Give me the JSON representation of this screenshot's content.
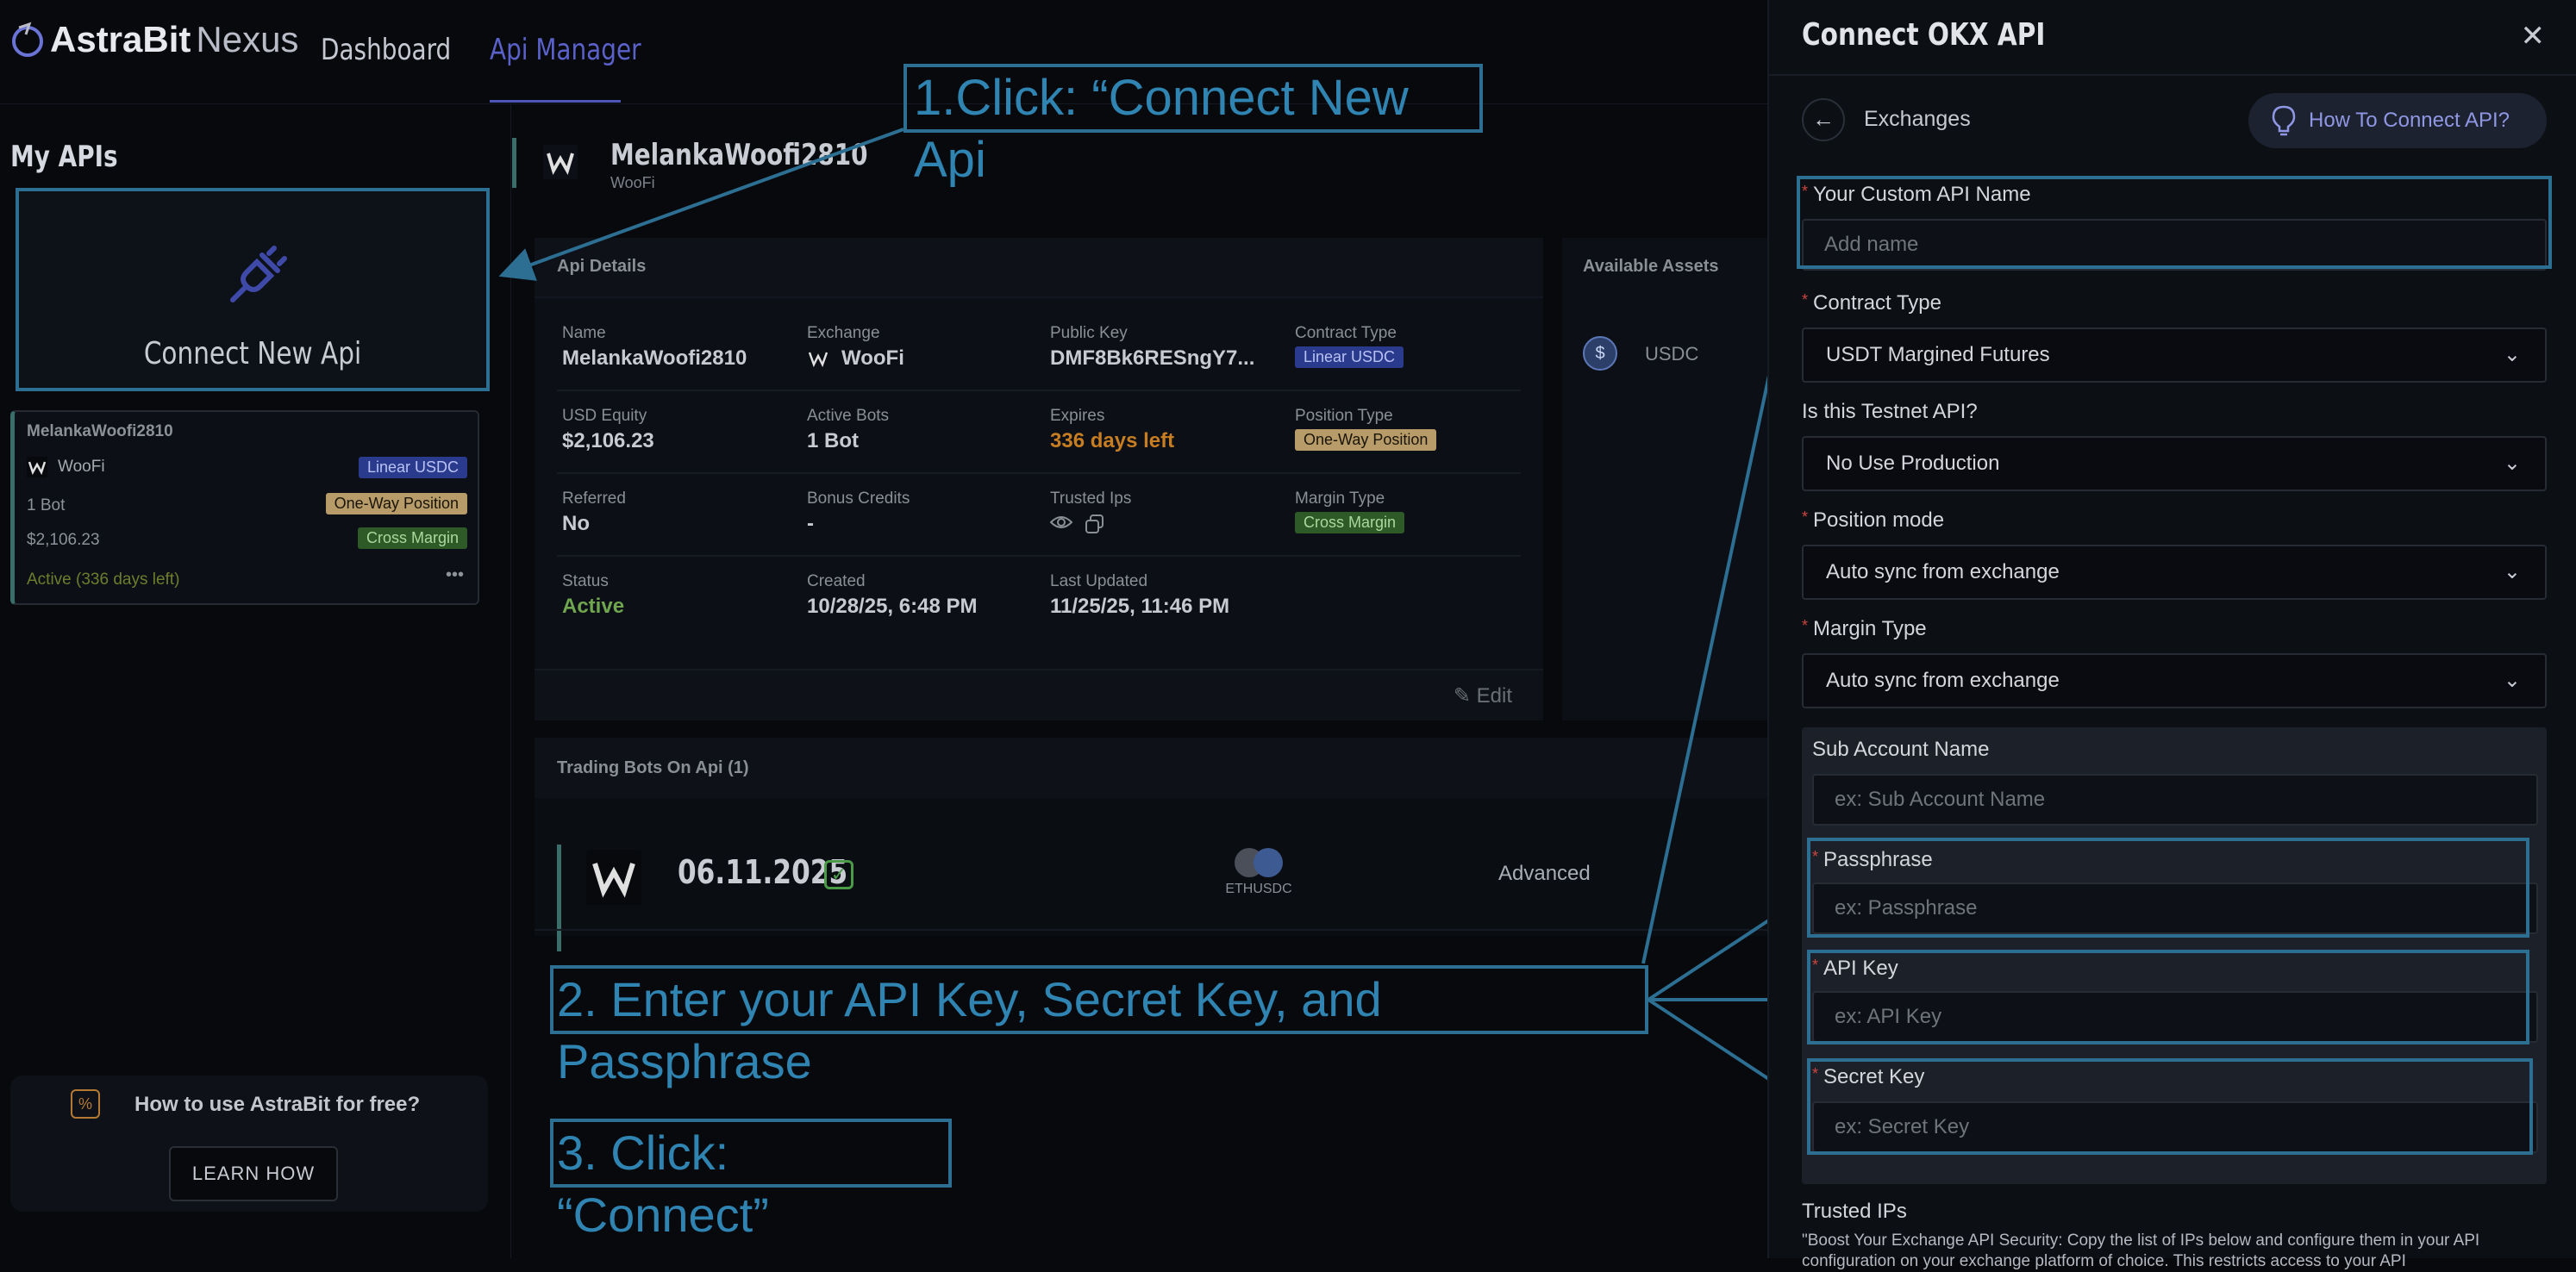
{
  "brand": {
    "name_bold": "AstraBit",
    "name_thin": "Nexus"
  },
  "nav": {
    "dashboard": "Dashboard",
    "api_manager": "Api Manager"
  },
  "left": {
    "my_apis": "My APIs",
    "connect_new": "Connect New Api",
    "card": {
      "name": "MelankaWoofi2810",
      "exchange": "WooFi",
      "tag_contract": "Linear USDC",
      "bots": "1 Bot",
      "tag_position": "One-Way Position",
      "equity": "$2,106.23",
      "tag_margin": "Cross Margin",
      "status": "Active (336 days left)",
      "more": "•••"
    },
    "free": {
      "question": "How to use AstraBit for free?",
      "button": "LEARN HOW"
    }
  },
  "main": {
    "api_name": "MelankaWoofi2810",
    "api_exchange": "WooFi",
    "details": {
      "title": "Api Details",
      "name_label": "Name",
      "name_value": "MelankaWoofi2810",
      "exchange_label": "Exchange",
      "exchange_value": "WooFi",
      "pubkey_label": "Public Key",
      "pubkey_value": "DMF8Bk6RESngY7...",
      "contract_label": "Contract Type",
      "contract_value": "Linear USDC",
      "equity_label": "USD Equity",
      "equity_value": "$2,106.23",
      "activebots_label": "Active Bots",
      "activebots_value": "1 Bot",
      "expires_label": "Expires",
      "expires_value": "336 days left",
      "position_label": "Position Type",
      "position_value": "One-Way Position",
      "referred_label": "Referred",
      "referred_value": "No",
      "bonus_label": "Bonus Credits",
      "bonus_value": "-",
      "trusted_label": "Trusted Ips",
      "margin_label": "Margin Type",
      "margin_value": "Cross Margin",
      "status_label": "Status",
      "status_value": "Active",
      "created_label": "Created",
      "created_value": "10/28/25, 6:48 PM",
      "updated_label": "Last Updated",
      "updated_value": "11/25/25, 11:46 PM",
      "edit": "Edit"
    },
    "assets": {
      "title": "Available Assets",
      "coin": "USDC"
    },
    "bots": {
      "title": "Trading Bots On Api (1)",
      "date": "06.11.2025",
      "pair": "ETHUSDC",
      "type": "Advanced"
    }
  },
  "annotations": {
    "step1": "1.Click: “Connect New Api",
    "step2": "2. Enter your API Key, Secret Key, and Passphrase",
    "step3": "3. Click: “Connect”"
  },
  "panel": {
    "title": "Connect OKX API",
    "close": "✕",
    "back_label": "Exchanges",
    "howto": "How To Connect API?",
    "custom_name_label": "Your Custom API Name",
    "custom_name_placeholder": "Add name",
    "contract_label": "Contract Type",
    "contract_value": "USDT Margined Futures",
    "testnet_label": "Is this Testnet API?",
    "testnet_value": "No Use Production",
    "position_label": "Position mode",
    "position_value": "Auto sync from exchange",
    "margin_label": "Margin Type",
    "margin_value": "Auto sync from exchange",
    "sub_label": "Sub Account Name",
    "sub_placeholder": "ex: Sub Account Name",
    "pass_label": "Passphrase",
    "pass_placeholder": "ex: Passphrase",
    "apikey_label": "API Key",
    "apikey_placeholder": "ex: API Key",
    "secret_label": "Secret Key",
    "secret_placeholder": "ex: Secret Key",
    "trusted_label": "Trusted IPs",
    "trusted_text": "\"Boost Your Exchange API Security: Copy the list of IPs below and configure them in your API configuration on your exchange platform of choice. This restricts access to your API"
  },
  "colors": {
    "accent": "#5a61c9",
    "annotation": "#2c6f92",
    "active": "#6fa64f",
    "warn": "#c77d22"
  }
}
